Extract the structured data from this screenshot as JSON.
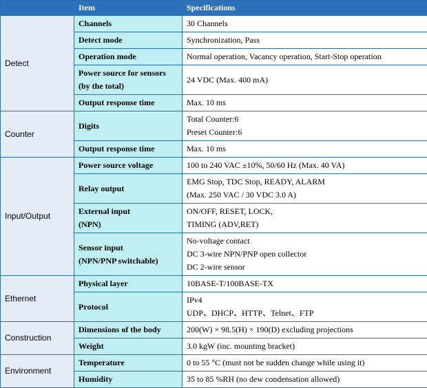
{
  "table": {
    "headers": {
      "category": "",
      "item": "Item",
      "specs": "Specifications"
    },
    "groups": [
      {
        "category": "Detect",
        "rows": [
          {
            "item": "Channels",
            "specs": [
              "30 Channels"
            ]
          },
          {
            "item": "Detect mode",
            "specs": [
              "Synchronization, Pass"
            ]
          },
          {
            "item": "Operation mode",
            "specs": [
              "Normal operation, Vacancy operation, Start-Stop operation"
            ]
          },
          {
            "item": "Power source for sensors\n(by the total)",
            "specs": [
              "24 VDC (Max. 400 mA)"
            ]
          },
          {
            "item": "Output response time",
            "specs": [
              "Max. 10 ms"
            ]
          }
        ]
      },
      {
        "category": "Counter",
        "rows": [
          {
            "item": "Digits",
            "specs": [
              "Total Counter:6",
              "Preset Counter:6"
            ]
          },
          {
            "item": "Output response time",
            "specs": [
              "Max. 10 ms"
            ]
          }
        ]
      },
      {
        "category": "Input/Output",
        "rows": [
          {
            "item": "Power source voltage",
            "specs": [
              "100 to 240 VAC ±10%, 50/60 Hz (Max. 40 VA)"
            ]
          },
          {
            "item": "Relay output",
            "specs": [
              "EMG Stop, TDC Stop, READY, ALARM",
              "(Max. 250 VAC / 30 VDC 3.0 A)"
            ]
          },
          {
            "item": "External input\n(NPN)",
            "specs": [
              "ON/OFF, RESET, LOCK,",
              "TIMING (ADV,RET)"
            ]
          },
          {
            "item": "Sensor input\n(NPN/PNP switchable)",
            "specs": [
              "No-voltage contact",
              "DC 3-wire NPN/PNP open collector",
              "DC 2-wire sensor"
            ]
          }
        ]
      },
      {
        "category": "Ethernet",
        "rows": [
          {
            "item": "Physical layer",
            "specs": [
              "10BASE-T/100BASE-TX"
            ]
          },
          {
            "item": "Protocol",
            "specs": [
              "IPv4",
              "UDP、DHCP、HTTP、Telnet、FTP"
            ]
          }
        ]
      },
      {
        "category": "Construction",
        "rows": [
          {
            "item": "Dimensions of the body",
            "specs": [
              "200(W) × 98.5(H) × 190(D) excluding projections"
            ]
          },
          {
            "item": "Weight",
            "specs": [
              "3.0 kgW (inc. mounting bracket)"
            ]
          }
        ]
      },
      {
        "category": "Environment",
        "rows": [
          {
            "item": "Temperature",
            "specs": [
              "0 to 55 °C (must not be sudden change while using it)"
            ]
          },
          {
            "item": "Humidity",
            "specs": [
              "35 to 85 %RH (no dew condensation allowed)"
            ]
          }
        ]
      }
    ]
  }
}
